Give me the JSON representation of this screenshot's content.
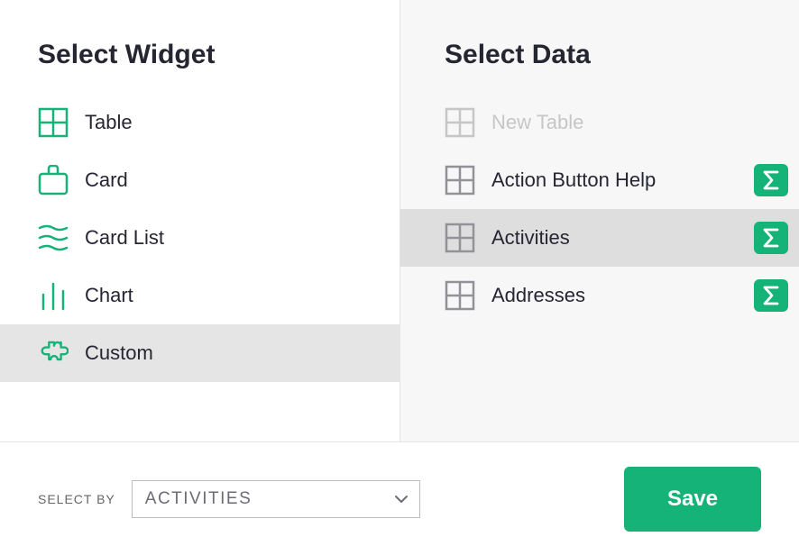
{
  "colors": {
    "accent": "#16b378"
  },
  "left": {
    "title": "Select Widget",
    "items": [
      {
        "label": "Table"
      },
      {
        "label": "Card"
      },
      {
        "label": "Card List"
      },
      {
        "label": "Chart"
      },
      {
        "label": "Custom"
      }
    ]
  },
  "right": {
    "title": "Select Data",
    "items": [
      {
        "label": "New Table"
      },
      {
        "label": "Action Button Help"
      },
      {
        "label": "Activities"
      },
      {
        "label": "Addresses"
      }
    ]
  },
  "footer": {
    "select_by_label": "SELECT BY",
    "select_by_value": "ACTIVITIES",
    "save_label": "Save"
  }
}
